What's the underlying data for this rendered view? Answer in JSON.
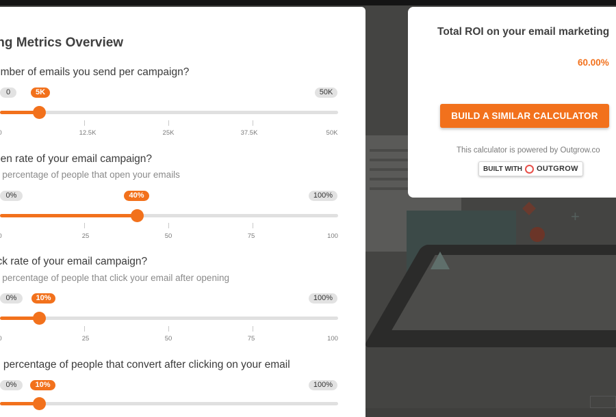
{
  "page": {
    "accent": "#f2711c"
  },
  "calculator": {
    "title": "ing Metrics Overview",
    "questions": [
      {
        "question": "umber of emails you send per campaign?",
        "hint": "",
        "min_label": "0",
        "max_label": "50K",
        "value_label": "5K",
        "value_fraction": 0.11,
        "ticks": [
          "0",
          "12.5K",
          "25K",
          "37.5K",
          "50K"
        ]
      },
      {
        "question": "pen rate of your email campaign?",
        "hint": "e percentage of people that open your emails",
        "min_label": "0%",
        "max_label": "100%",
        "value_label": "40%",
        "value_fraction": 0.4,
        "ticks": [
          "0",
          "25",
          "50",
          "75",
          "100"
        ]
      },
      {
        "question": "ick rate of your email campaign?",
        "hint": "e percentage of people that click your email after opening",
        "min_label": "0%",
        "max_label": "100%",
        "value_label": "10%",
        "value_fraction": 0.11,
        "ticks": [
          "0",
          "25",
          "50",
          "75",
          "100"
        ]
      },
      {
        "question": "e percentage of people that convert after clicking on your email",
        "hint": "",
        "min_label": "0%",
        "max_label": "100%",
        "value_label": "10%",
        "value_fraction": 0.11,
        "ticks": []
      }
    ]
  },
  "result": {
    "title": "Total ROI on your email marketing",
    "value": "60.00%",
    "cta_label": "BUILD A SIMILAR CALCULATOR",
    "powered_by": "This calculator is powered by Outgrow.co",
    "badge_prefix": "BUILT WITH",
    "badge_brand": "OUTGROW"
  }
}
